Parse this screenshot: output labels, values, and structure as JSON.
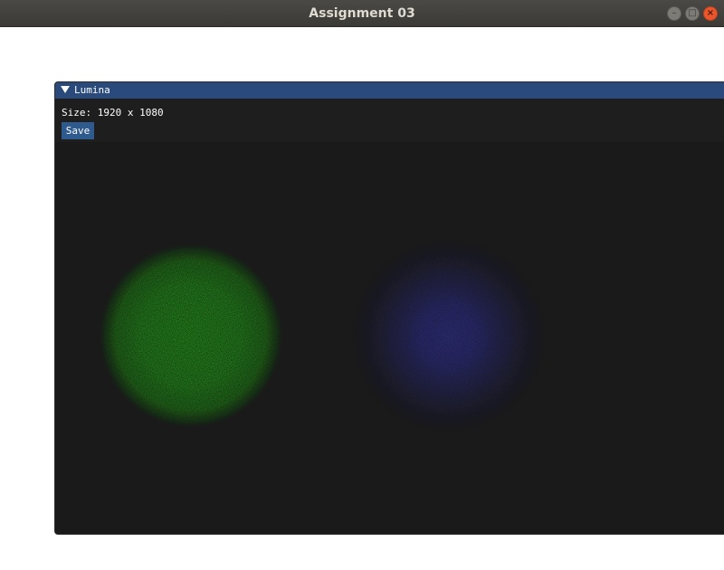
{
  "window": {
    "title": "Assignment 03",
    "buttons": {
      "minimize_glyph": "–",
      "maximize_glyph": "□",
      "close_glyph": "×"
    }
  },
  "panel": {
    "title": "Lumina",
    "size_label": "Size: 1920 x 1080",
    "save_label": "Save"
  },
  "render": {
    "background_color": "#1a1a1a",
    "spheres": [
      {
        "name": "green-sphere",
        "color": "#22ee11",
        "style": "solid-noisy"
      },
      {
        "name": "blue-sphere",
        "color": "#3333dd",
        "style": "diffuse-noisy"
      }
    ]
  },
  "colors": {
    "os_titlebar": "#3f3e3a",
    "imgui_titlebar": "#294a7a",
    "imgui_button": "#2f5a8e",
    "imgui_background": "#1e1e1e"
  }
}
